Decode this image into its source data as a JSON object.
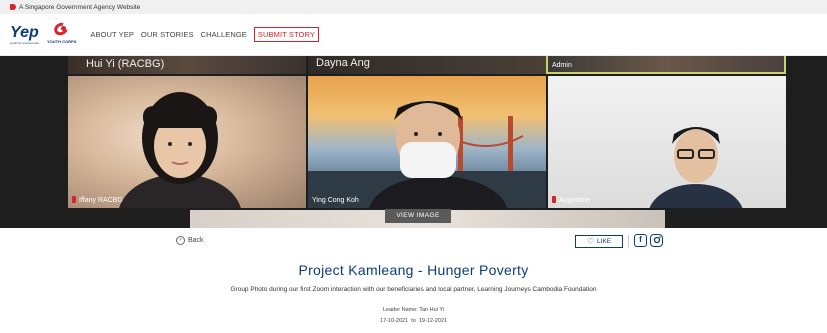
{
  "masthead": {
    "text": "A Singapore Government Agency Website"
  },
  "logos": {
    "yep": "Yep",
    "yep_sub": "youth for environment",
    "yc": "YOUTH CORPS"
  },
  "nav": {
    "links": [
      "ABOUT YEP",
      "OUR STORIES",
      "CHALLENGE"
    ],
    "cta": "SUBMIT STORY"
  },
  "hero": {
    "participants": {
      "top_left": "Hui Yi (RACBG)",
      "top_mid": "Dayna Ang",
      "top_right": "Admin",
      "left": "Iffany RACBG",
      "mid": "Ying Cong Koh",
      "right": "Augustine"
    },
    "view_button": "VIEW IMAGE"
  },
  "actions": {
    "back": "Back",
    "like": "LIKE"
  },
  "story": {
    "title": "Project Kamleang - Hunger Poverty",
    "caption": "Group Photo during our first Zoom interaction with our beneficiaries and local partner, Learning Journeys Cambodia Foundation",
    "leader": "Leader Name: Tan Hui Yi",
    "dates": "17-10-2021  to  19-12-2021"
  },
  "colors": {
    "brand_blue": "#0b3c7a",
    "brand_red": "#d8232a"
  }
}
